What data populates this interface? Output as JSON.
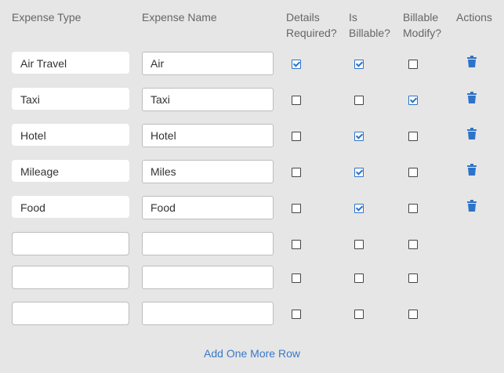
{
  "headers": {
    "expense_type": "Expense Type",
    "expense_name": "Expense Name",
    "details_required_1": "Details",
    "details_required_2": "Required?",
    "is_billable_1": "Is",
    "is_billable_2": "Billable?",
    "billable_modify_1": "Billable",
    "billable_modify_2": "Modify?",
    "actions": "Actions"
  },
  "rows": [
    {
      "type": "Air Travel",
      "name": "Air",
      "details_required": true,
      "is_billable": true,
      "billable_modify": false,
      "has_delete": true
    },
    {
      "type": "Taxi",
      "name": "Taxi",
      "details_required": false,
      "is_billable": false,
      "billable_modify": true,
      "has_delete": true
    },
    {
      "type": "Hotel",
      "name": "Hotel",
      "details_required": false,
      "is_billable": true,
      "billable_modify": false,
      "has_delete": true
    },
    {
      "type": "Mileage",
      "name": "Miles",
      "details_required": false,
      "is_billable": true,
      "billable_modify": false,
      "has_delete": true
    },
    {
      "type": "Food",
      "name": "Food",
      "details_required": false,
      "is_billable": true,
      "billable_modify": false,
      "has_delete": true
    },
    {
      "type": "",
      "name": "",
      "details_required": false,
      "is_billable": false,
      "billable_modify": false,
      "has_delete": false
    },
    {
      "type": "",
      "name": "",
      "details_required": false,
      "is_billable": false,
      "billable_modify": false,
      "has_delete": false
    },
    {
      "type": "",
      "name": "",
      "details_required": false,
      "is_billable": false,
      "billable_modify": false,
      "has_delete": false
    }
  ],
  "add_row_label": "Add One More Row",
  "colors": {
    "accent": "#2e73c8",
    "link": "#3a78c8",
    "background": "#e6e6e6"
  },
  "icons": {
    "delete": "trash-icon"
  }
}
